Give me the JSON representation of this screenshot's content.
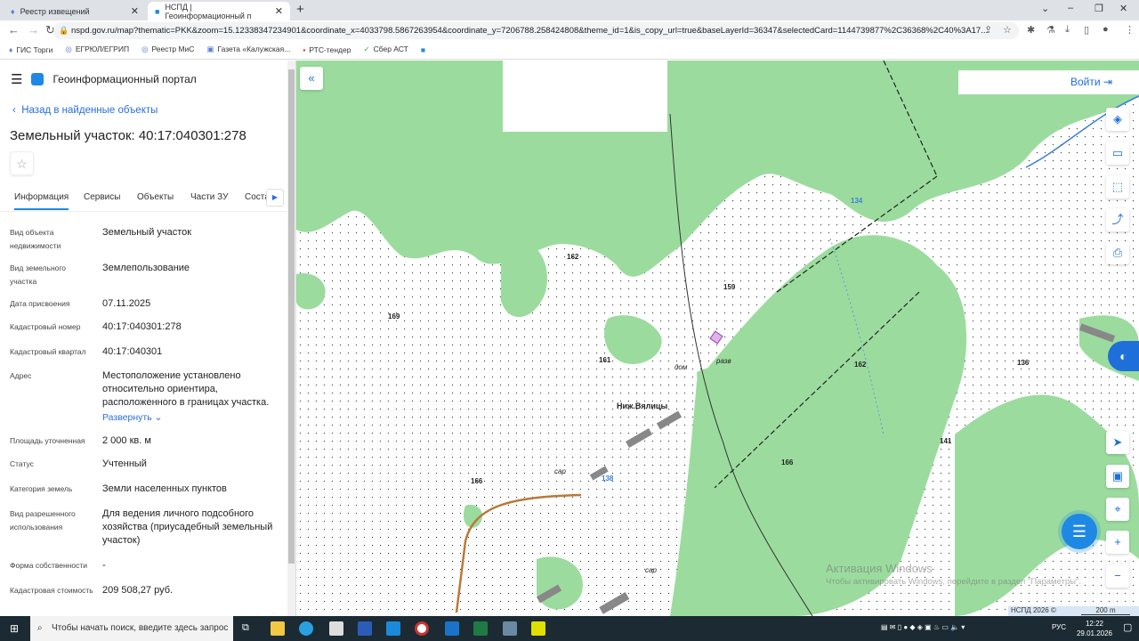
{
  "browser": {
    "tabs": [
      {
        "label": "Реестр извещений",
        "close": "✕"
      },
      {
        "label": "НСПД | Геоинформационный п",
        "close": "✕"
      }
    ],
    "new_tab": "+",
    "url": "nspd.gov.ru/map?thematic=PKK&zoom=15.12338347234901&coordinate_x=4033798.5867263954&coordinate_y=7206788.258424808&theme_id=1&is_copy_url=true&baseLayerId=36347&selectedCard=1144739877%2C36368%2C40%3A17...",
    "bookmarks": [
      "ГИС Торги",
      "ЕГРЮЛ/ЕГРИП",
      "Реестр МиС",
      "Газета «Калужская...",
      "РТС-тендер",
      "Сбер АСТ"
    ]
  },
  "panel": {
    "app_title": "Геоинформационный портал",
    "back_link": "Назад в найденные объекты",
    "title": "Земельный участок: 40:17:040301:278",
    "tabs": [
      "Информация",
      "Сервисы",
      "Объекты",
      "Части ЗУ",
      "Соста"
    ],
    "fields": [
      {
        "key": "Вид объекта недвижимости",
        "value": "Земельный участок"
      },
      {
        "key": "Вид земельного участка",
        "value": "Землепользование"
      },
      {
        "key": "Дата присвоения",
        "value": "07.11.2025"
      },
      {
        "key": "Кадастровый номер",
        "value": "40:17:040301:278"
      },
      {
        "key": "Кадастровый квартал",
        "value": "40:17:040301"
      },
      {
        "key": "Адрес",
        "value": "Местоположение установлено относительно ориентира, расположенного в границах участка."
      },
      {
        "key": "Площадь уточненная",
        "value": "2 000 кв. м"
      },
      {
        "key": "Статус",
        "value": "Учтенный"
      },
      {
        "key": "Категория земель",
        "value": "Земли населенных пунктов"
      },
      {
        "key": "Вид разрешенного использования",
        "value": "Для ведения личного подсобного хозяйства (приусадебный земельный участок)"
      },
      {
        "key": "Форма собственности",
        "value": "-"
      },
      {
        "key": "Кадастровая стоимость",
        "value": "209 508,27 руб."
      }
    ],
    "expand_link": "Развернуть"
  },
  "map": {
    "login": "Войти",
    "labels": [
      "162",
      "159",
      "169",
      "161",
      "162",
      "136",
      "141",
      "166",
      "166",
      "134",
      "138",
      "Ниж.Вялицы",
      "дом",
      "разв",
      "сар",
      "сар"
    ],
    "copyright": "НСПД 2026 ©",
    "scale": "200 m",
    "watermark_title": "Активация Windows",
    "watermark_text": "Чтобы активировать Windows, перейдите в раздел \"Параметры\".",
    "colors": {
      "forest": "#9bdc9e",
      "accent": "#1e6fd9"
    }
  },
  "taskbar": {
    "search_placeholder": "Чтобы начать поиск, введите здесь запрос",
    "lang": "РУС",
    "time": "12:22",
    "date": "29.01.2026"
  }
}
